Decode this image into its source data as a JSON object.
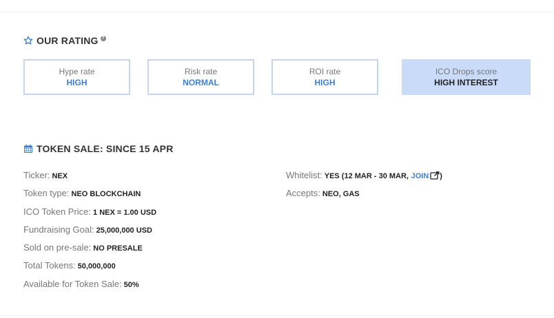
{
  "rating": {
    "title": "OUR RATING",
    "help": "?",
    "boxes": [
      {
        "label": "Hype rate",
        "value": "HIGH"
      },
      {
        "label": "Risk rate",
        "value": "NORMAL"
      },
      {
        "label": "ROI rate",
        "value": "HIGH"
      },
      {
        "label": "ICO Drops score",
        "value": "HIGH INTEREST"
      }
    ]
  },
  "token_sale": {
    "title": "TOKEN SALE: SINCE 15 APR",
    "left": [
      {
        "label": "Ticker:",
        "value": "NEX"
      },
      {
        "label": "Token type:",
        "value": "NEO BLOCKCHAIN"
      },
      {
        "label": "ICO Token Price:",
        "value": "1 NEX = 1.00 USD"
      },
      {
        "label": "Fundraising Goal:",
        "value": "25,000,000 USD"
      },
      {
        "label": "Sold on pre-sale:",
        "value": "NO PRESALE"
      },
      {
        "label": "Total Tokens:",
        "value": "50,000,000"
      },
      {
        "label": "Available for Token Sale:",
        "value": "50%"
      }
    ],
    "whitelist": {
      "label": "Whitelist:",
      "value": "YES (12 MAR - 30 MAR,",
      "link": "JOIN",
      "close": ")"
    },
    "accepts": {
      "label": "Accepts:",
      "value": "NEO, GAS"
    }
  },
  "colors": {
    "accent": "#3f7fcf",
    "highlight_box": "#c9dbf9",
    "box_border": "#c7d5ec"
  },
  "icons": {
    "rating": "star-outline-icon",
    "token_sale": "calendar-icon",
    "external": "external-link-icon"
  }
}
